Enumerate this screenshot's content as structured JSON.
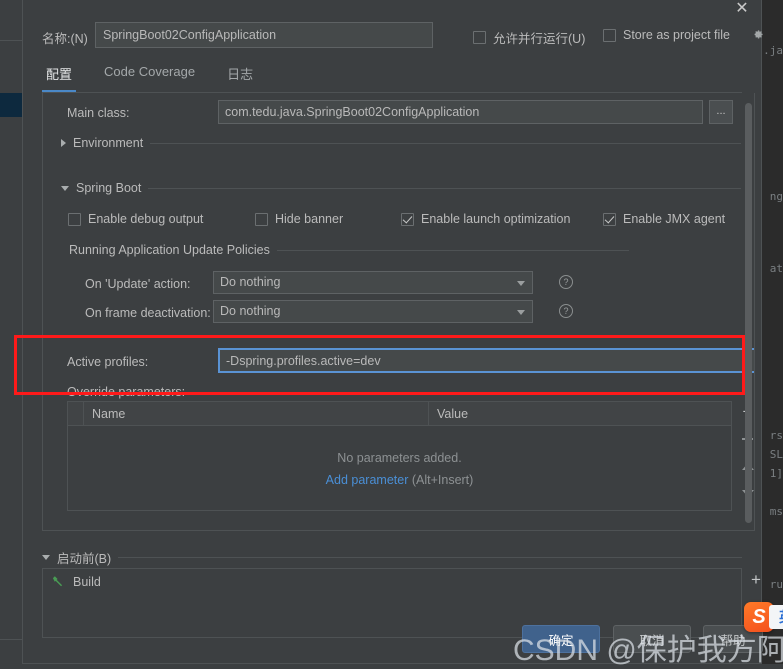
{
  "dialog": {
    "close_icon": "close-icon",
    "name_label": "名称:(N)",
    "name_value": "SpringBoot02ConfigApplication",
    "allow_parallel_label": "允许并行运行(U)",
    "allow_parallel_checked": false,
    "store_project_file_label": "Store as project file",
    "store_project_file_checked": false,
    "store_gear_icon": "gear-icon"
  },
  "tabs": [
    {
      "label": "配置",
      "active": true
    },
    {
      "label": "Code Coverage",
      "active": false
    },
    {
      "label": "日志",
      "active": false
    }
  ],
  "configuration": {
    "main_class_label": "Main class:",
    "main_class_value": "com.tedu.java.SpringBoot02ConfigApplication",
    "browse_button_label": "...",
    "environment_group": "Environment",
    "spring_boot_group": "Spring Boot",
    "spring_boot_checkboxes": [
      {
        "label": "Enable debug output",
        "checked": false
      },
      {
        "label": "Hide banner",
        "checked": false
      },
      {
        "label": "Enable launch optimization",
        "checked": true
      },
      {
        "label": "Enable JMX agent",
        "checked": true
      }
    ],
    "update_policies_group": "Running Application Update Policies",
    "on_update_label": "On 'Update' action:",
    "on_update_value": "Do nothing",
    "on_frame_label": "On frame deactivation:",
    "on_frame_value": "Do nothing",
    "help_icon": "help-icon",
    "active_profiles_label": "Active profiles:",
    "active_profiles_value": "-Dspring.profiles.active=dev",
    "override_parameters_label": "Override parameters:",
    "param_table": {
      "columns": [
        "Name",
        "Value"
      ],
      "rows": [],
      "empty_text": "No parameters added.",
      "add_link": "Add parameter",
      "add_hint": "(Alt+Insert)"
    },
    "table_toolbar": {
      "add_icon": "plus-icon",
      "remove_icon": "minus-icon",
      "move_up_icon": "arrow-up-icon",
      "move_down_icon": "arrow-down-icon"
    }
  },
  "before_launch": {
    "group_label": "启动前(B)",
    "items": [
      {
        "label": "Build",
        "icon": "hammer-icon"
      }
    ],
    "toolbar": {
      "add_icon": "plus-icon",
      "remove_icon": "minus-icon"
    }
  },
  "footer": {
    "ok_label": "确定",
    "cancel_label": "取消",
    "help_label": "帮助"
  },
  "overlay": {
    "watermark": "CSDN @保护我方阿遥",
    "ime_logo": "S",
    "ime_mode": "英"
  },
  "background": {
    "code_fragments": [
      ".ja",
      "ng",
      "at",
      "rs",
      "SL",
      "1]",
      "ms",
      "ru"
    ]
  },
  "colors": {
    "dialog_bg": "#3c3f41",
    "field_bg": "#45494a",
    "border": "#4e5254",
    "accent_blue": "#4a88c7",
    "focus_border": "#5a93d4",
    "link_blue": "#4a8fd6",
    "ok_button": "#40628c",
    "annotation_red": "#ff1a1a",
    "hammer_green": "#499c54",
    "editor_bg": "#2b2b2b"
  }
}
